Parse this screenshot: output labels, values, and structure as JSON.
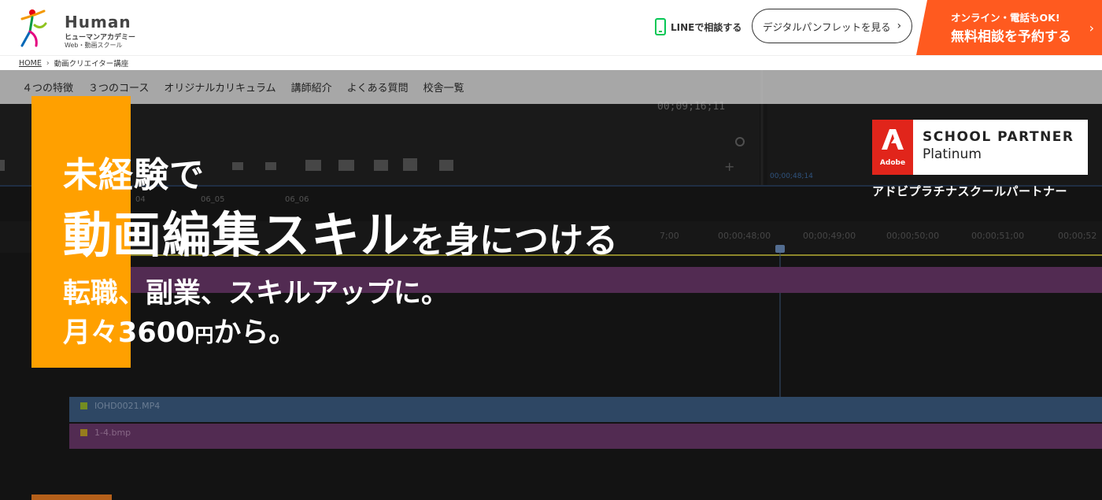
{
  "header": {
    "logo_word": "Human",
    "logo_sub1": "ヒューマンアカデミー",
    "logo_sub2": "Web・動画スクール",
    "line_label": "LINEで相談する",
    "pamphlet_label": "デジタルパンフレットを見る",
    "cta_sub": "オンライン・電話もOK!",
    "cta_main": "無料相談を予約する"
  },
  "breadcrumb": {
    "home": "HOME",
    "current": "動画クリエイター講座"
  },
  "subnav": {
    "items": [
      "４つの特徴",
      "３つのコース",
      "オリジナルカリキュラム",
      "講師紹介",
      "よくある質問",
      "校舎一覧"
    ]
  },
  "hero": {
    "line1": "未経験で",
    "line2_big": "動画編集スキル",
    "line2_small": "を身につける",
    "line3": "転職、副業、スキルアップに。",
    "line4_pre": "月々3600",
    "line4_yen": "円",
    "line4_post": "から。"
  },
  "badge": {
    "adobe_word": "Adobe",
    "title": "SCHOOL PARTNER",
    "level": "Platinum",
    "caption": "アドビプラチナスクールパートナー"
  },
  "editor": {
    "timecode_main": "00;09;16;11",
    "timecode_side": "00;00;48;14",
    "tab_1": "04",
    "tab_2": "06_05",
    "tab_3": "06_06",
    "ruler": [
      "7;00",
      "00;00;48;00",
      "00;00;49;00",
      "00;00;50;00",
      "00;00;51;00",
      "00;00;52"
    ],
    "clip_video": "IOHD0021.MP4",
    "clip_image": "1-4.bmp"
  },
  "colors": {
    "accent_orange": "#ff5a1f",
    "hero_bar": "#ffa000",
    "adobe_red": "#e1251b",
    "line_green": "#06c755"
  }
}
